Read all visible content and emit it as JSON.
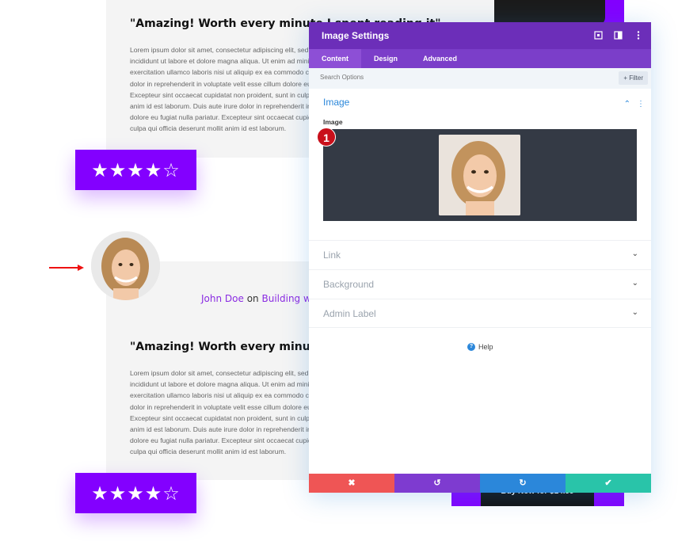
{
  "background": {
    "card1": {
      "quote": "\"Amazing! Worth every minute I spent reading it\"",
      "text": "Lorem ipsum dolor sit amet, consectetur adipiscing elit, sed do eiusmod tempor incididunt ut labore et dolore magna aliqua. Ut enim ad minim veniam, quis nostrud exercitation ullamco laboris nisi ut aliquip ex ea commodo consequat. Duis aute irure dolor in reprehenderit in voluptate velit esse cillum dolore eu fugiat nulla pariatur. Excepteur sint occaecat cupidatat non proident, sunt in culpa qui officia deserunt mollit anim id est laborum. Duis aute irure dolor in reprehenderit in voluptate velit esse cillum dolore eu fugiat nulla pariatur. Excepteur sint occaecat cupidatat non proident, sunt in culpa qui officia deserunt mollit anim id est laborum."
    },
    "rating1": {
      "stars": "★★★★☆",
      "value": 4,
      "max": 5
    },
    "author": {
      "name": "John Doe",
      "on": "on",
      "book": "Building with Divi"
    },
    "card2": {
      "quote": "\"Amazing! Worth every minute I spent reading it\"",
      "text": "Lorem ipsum dolor sit amet, consectetur adipiscing elit, sed do eiusmod tempor incididunt ut labore et dolore magna aliqua. Ut enim ad minim veniam, quis nostrud exercitation ullamco laboris nisi ut aliquip ex ea commodo consequat. Duis aute irure dolor in reprehenderit in voluptate velit esse cillum dolore eu fugiat nulla pariatur. Excepteur sint occaecat cupidatat non proident, sunt in culpa qui officia deserunt mollit anim id est laborum. Duis aute irure dolor in reprehenderit in voluptate velit esse cillum dolore eu fugiat nulla pariatur. Excepteur sint occaecat cupidatat non proident, sunt in culpa qui officia deserunt mollit anim id est laborum."
    },
    "rating2": {
      "stars": "★★★★☆",
      "value": 4,
      "max": 5
    },
    "phone_bottom_text": "Buy Now for $14.99"
  },
  "modal": {
    "title": "Image Settings",
    "tabs": [
      {
        "label": "Content",
        "active": true
      },
      {
        "label": "Design",
        "active": false
      },
      {
        "label": "Advanced",
        "active": false
      }
    ],
    "search_placeholder": "Search Options",
    "filter_label": "Filter",
    "section_image": "Image",
    "field_image_label": "Image",
    "step_badge": "1",
    "toggles": [
      {
        "label": "Link"
      },
      {
        "label": "Background"
      },
      {
        "label": "Admin Label"
      }
    ],
    "help_label": "Help"
  },
  "colors": {
    "brand_purple": "#8300ff",
    "modal_header": "#6c2eb9",
    "section_blue": "#2b87da",
    "discard_red": "#ef5555",
    "save_green": "#29c4a9"
  }
}
